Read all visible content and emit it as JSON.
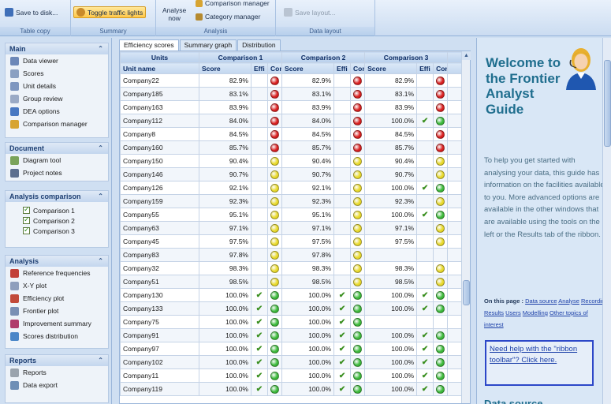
{
  "ribbon": {
    "save_to_disk": "Save to disk...",
    "toggle_traffic_lights": "Toggle traffic lights",
    "analyse_now_line1": "Analyse",
    "analyse_now_line2": "now",
    "comparison_manager": "Comparison manager",
    "category_manager": "Category manager",
    "save_layout": "Save layout...",
    "groups": [
      "Table copy",
      "Summary",
      "Analysis",
      "Data layout"
    ]
  },
  "left_panel": {
    "main": {
      "title": "Main",
      "items": [
        "Data viewer",
        "Scores",
        "Unit details",
        "Group review",
        "DEA options",
        "Comparison manager"
      ]
    },
    "document": {
      "title": "Document",
      "items": [
        "Diagram tool",
        "Project notes"
      ]
    },
    "analysis_comparison": {
      "title": "Analysis comparison",
      "items": [
        "Comparison 1",
        "Comparison 2",
        "Comparison 3"
      ]
    },
    "analysis": {
      "title": "Analysis",
      "items": [
        "Reference frequencies",
        "X-Y plot",
        "Efficiency plot",
        "Frontier plot",
        "Improvement summary",
        "Scores distribution"
      ]
    },
    "reports": {
      "title": "Reports",
      "items": [
        "Reports",
        "Data export"
      ]
    }
  },
  "tabs": [
    "Efficiency scores",
    "Summary graph",
    "Distribution"
  ],
  "table": {
    "header_units": "Units",
    "header_groups": [
      "Comparison 1",
      "Comparison 2",
      "Comparison 3"
    ],
    "col_unit_name": "Unit name",
    "col_score": "Score",
    "col_effi": "Effi",
    "col_con": "Con",
    "rows": [
      {
        "name": "Company22",
        "c1": "82.9%",
        "t1": "",
        "l1": "red",
        "c2": "82.9%",
        "t2": "",
        "l2": "red",
        "c3": "82.9%",
        "t3": "",
        "l3": "red"
      },
      {
        "name": "Company185",
        "c1": "83.1%",
        "t1": "",
        "l1": "red",
        "c2": "83.1%",
        "t2": "",
        "l2": "red",
        "c3": "83.1%",
        "t3": "",
        "l3": "red"
      },
      {
        "name": "Company163",
        "c1": "83.9%",
        "t1": "",
        "l1": "red",
        "c2": "83.9%",
        "t2": "",
        "l2": "red",
        "c3": "83.9%",
        "t3": "",
        "l3": "red"
      },
      {
        "name": "Company112",
        "c1": "84.0%",
        "t1": "",
        "l1": "red",
        "c2": "84.0%",
        "t2": "",
        "l2": "red",
        "c3": "100.0%",
        "t3": "✔",
        "l3": "green"
      },
      {
        "name": "Company8",
        "c1": "84.5%",
        "t1": "",
        "l1": "red",
        "c2": "84.5%",
        "t2": "",
        "l2": "red",
        "c3": "84.5%",
        "t3": "",
        "l3": "red"
      },
      {
        "name": "Company160",
        "c1": "85.7%",
        "t1": "",
        "l1": "red",
        "c2": "85.7%",
        "t2": "",
        "l2": "red",
        "c3": "85.7%",
        "t3": "",
        "l3": "red"
      },
      {
        "name": "Company150",
        "c1": "90.4%",
        "t1": "",
        "l1": "yellow",
        "c2": "90.4%",
        "t2": "",
        "l2": "yellow",
        "c3": "90.4%",
        "t3": "",
        "l3": "yellow"
      },
      {
        "name": "Company146",
        "c1": "90.7%",
        "t1": "",
        "l1": "yellow",
        "c2": "90.7%",
        "t2": "",
        "l2": "yellow",
        "c3": "90.7%",
        "t3": "",
        "l3": "yellow"
      },
      {
        "name": "Company126",
        "c1": "92.1%",
        "t1": "",
        "l1": "yellow",
        "c2": "92.1%",
        "t2": "",
        "l2": "yellow",
        "c3": "100.0%",
        "t3": "✔",
        "l3": "green"
      },
      {
        "name": "Company159",
        "c1": "92.3%",
        "t1": "",
        "l1": "yellow",
        "c2": "92.3%",
        "t2": "",
        "l2": "yellow",
        "c3": "92.3%",
        "t3": "",
        "l3": "yellow"
      },
      {
        "name": "Company55",
        "c1": "95.1%",
        "t1": "",
        "l1": "yellow",
        "c2": "95.1%",
        "t2": "",
        "l2": "yellow",
        "c3": "100.0%",
        "t3": "✔",
        "l3": "green"
      },
      {
        "name": "Company63",
        "c1": "97.1%",
        "t1": "",
        "l1": "yellow",
        "c2": "97.1%",
        "t2": "",
        "l2": "yellow",
        "c3": "97.1%",
        "t3": "",
        "l3": "yellow"
      },
      {
        "name": "Company45",
        "c1": "97.5%",
        "t1": "",
        "l1": "yellow",
        "c2": "97.5%",
        "t2": "",
        "l2": "yellow",
        "c3": "97.5%",
        "t3": "",
        "l3": "yellow"
      },
      {
        "name": "Company83",
        "c1": "97.8%",
        "t1": "",
        "l1": "yellow",
        "c2": "97.8%",
        "t2": "",
        "l2": "yellow",
        "c3": "",
        "t3": "",
        "l3": ""
      },
      {
        "name": "Company32",
        "c1": "98.3%",
        "t1": "",
        "l1": "yellow",
        "c2": "98.3%",
        "t2": "",
        "l2": "yellow",
        "c3": "98.3%",
        "t3": "",
        "l3": "yellow"
      },
      {
        "name": "Company51",
        "c1": "98.5%",
        "t1": "",
        "l1": "yellow",
        "c2": "98.5%",
        "t2": "",
        "l2": "yellow",
        "c3": "98.5%",
        "t3": "",
        "l3": "yellow"
      },
      {
        "name": "Company130",
        "c1": "100.0%",
        "t1": "✔",
        "l1": "green",
        "c2": "100.0%",
        "t2": "✔",
        "l2": "green",
        "c3": "100.0%",
        "t3": "✔",
        "l3": "green"
      },
      {
        "name": "Company133",
        "c1": "100.0%",
        "t1": "✔",
        "l1": "green",
        "c2": "100.0%",
        "t2": "✔",
        "l2": "green",
        "c3": "100.0%",
        "t3": "✔",
        "l3": "green"
      },
      {
        "name": "Company75",
        "c1": "100.0%",
        "t1": "✔",
        "l1": "green",
        "c2": "100.0%",
        "t2": "✔",
        "l2": "green",
        "c3": "",
        "t3": "",
        "l3": ""
      },
      {
        "name": "Company91",
        "c1": "100.0%",
        "t1": "✔",
        "l1": "green",
        "c2": "100.0%",
        "t2": "✔",
        "l2": "green",
        "c3": "100.0%",
        "t3": "✔",
        "l3": "green"
      },
      {
        "name": "Company97",
        "c1": "100.0%",
        "t1": "✔",
        "l1": "green",
        "c2": "100.0%",
        "t2": "✔",
        "l2": "green",
        "c3": "100.0%",
        "t3": "✔",
        "l3": "green"
      },
      {
        "name": "Company102",
        "c1": "100.0%",
        "t1": "✔",
        "l1": "green",
        "c2": "100.0%",
        "t2": "✔",
        "l2": "green",
        "c3": "100.0%",
        "t3": "✔",
        "l3": "green"
      },
      {
        "name": "Company11",
        "c1": "100.0%",
        "t1": "✔",
        "l1": "green",
        "c2": "100.0%",
        "t2": "✔",
        "l2": "green",
        "c3": "100.0%",
        "t3": "✔",
        "l3": "green"
      },
      {
        "name": "Company119",
        "c1": "100.0%",
        "t1": "✔",
        "l1": "green",
        "c2": "100.0%",
        "t2": "✔",
        "l2": "green",
        "c3": "100.0%",
        "t3": "✔",
        "l3": "green"
      }
    ]
  },
  "light_colors": {
    "red": "#d81f1f",
    "yellow": "#e8d92a",
    "green": "#3cb93a"
  },
  "guide": {
    "title": "Welcome to the Frontier Analyst Guide",
    "intro": "To help you get started with analysing your data, this guide has information on the facilities available to you. More advanced options are available in the other windows that are available using the tools on the left or the Results tab of the ribbon.",
    "on_this_page": "On this page :",
    "links": [
      "Data source",
      "Analyse",
      "Recording",
      "Results",
      "Users",
      "Modelling",
      "Other topics of interest"
    ],
    "help_text": "Need help with the \"ribbon toolbar\"? Click here.",
    "more_heading": "Data source"
  }
}
